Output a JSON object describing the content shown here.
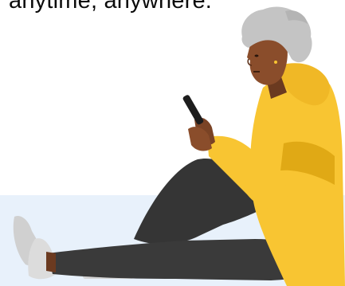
{
  "hero": {
    "headline_fragment": "anytime, anywhere."
  },
  "colors": {
    "floor": "#e8f1fb",
    "hoodie": "#f8c532",
    "hoodie_shadow": "#e0a915",
    "pants": "#3a3a3a",
    "skin": "#8a4d2b",
    "hair": "#c4c4c4",
    "shoe": "#d4d4d4",
    "phone": "#1d1d1d"
  },
  "illustration": {
    "icon": "person-sitting-with-phone-icon"
  }
}
